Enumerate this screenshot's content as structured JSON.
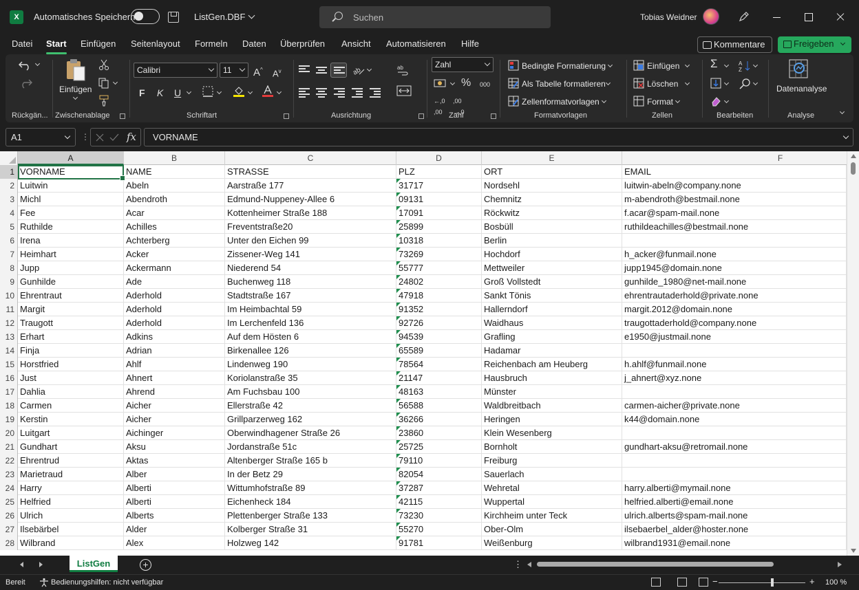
{
  "titlebar": {
    "autosave_label": "Automatisches Speichern",
    "filename": "ListGen.DBF",
    "search_placeholder": "Suchen",
    "user": "Tobias Weidner"
  },
  "menu": {
    "tabs": [
      "Datei",
      "Start",
      "Einfügen",
      "Seitenlayout",
      "Formeln",
      "Daten",
      "Überprüfen",
      "Ansicht",
      "Automatisieren",
      "Hilfe"
    ],
    "active_tab": "Start",
    "comments_label": "Kommentare",
    "share_label": "Freigeben"
  },
  "ribbon": {
    "undo_group": "Rückgän...",
    "clipboard": {
      "paste_label": "Einfügen",
      "group": "Zwischenablage"
    },
    "font": {
      "name": "Calibri",
      "size": "11",
      "bold": "F",
      "italic": "K",
      "underline": "U",
      "group": "Schriftart"
    },
    "alignment": {
      "group": "Ausrichtung"
    },
    "number": {
      "format": "Zahl",
      "group": "Zahl"
    },
    "styles": {
      "conditional": "Bedingte Formatierung",
      "as_table": "Als Tabelle formatieren",
      "cell_styles": "Zellenformatvorlagen",
      "group": "Formatvorlagen"
    },
    "cells": {
      "insert": "Einfügen",
      "delete": "Löschen",
      "format": "Format",
      "group": "Zellen"
    },
    "editing": {
      "group": "Bearbeiten"
    },
    "analysis": {
      "button": "Datenanalyse",
      "group": "Analyse"
    }
  },
  "formula_bar": {
    "name_box": "A1",
    "fx": "fx",
    "content": "VORNAME"
  },
  "sheet": {
    "columns": [
      "A",
      "B",
      "C",
      "D",
      "E",
      "F"
    ],
    "rows": [
      [
        "VORNAME",
        "NAME",
        "STRASSE",
        "PLZ",
        "ORT",
        "EMAIL"
      ],
      [
        "Luitwin",
        "Abeln",
        "Aarstraße 177",
        "31717",
        "Nordsehl",
        "luitwin-abeln@company.none"
      ],
      [
        "Michl",
        "Abendroth",
        "Edmund-Nuppeney-Allee 6",
        "09131",
        "Chemnitz",
        "m-abendroth@bestmail.none"
      ],
      [
        "Fee",
        "Acar",
        "Kottenheimer Straße 188",
        "17091",
        "Röckwitz",
        "f.acar@spam-mail.none"
      ],
      [
        "Ruthilde",
        "Achilles",
        "Freventstraße20",
        "25899",
        "Bosbüll",
        "ruthildeachilles@bestmail.none"
      ],
      [
        "Irena",
        "Achterberg",
        "Unter den Eichen 99",
        "10318",
        "Berlin",
        ""
      ],
      [
        "Heimhart",
        "Acker",
        "Zissener-Weg 141",
        "73269",
        "Hochdorf",
        "h_acker@funmail.none"
      ],
      [
        "Jupp",
        "Ackermann",
        "Niederend 54",
        "55777",
        "Mettweiler",
        "jupp1945@domain.none"
      ],
      [
        "Gunhilde",
        "Ade",
        "Buchenweg 118",
        "24802",
        "Groß Vollstedt",
        "gunhilde_1980@net-mail.none"
      ],
      [
        "Ehrentraut",
        "Aderhold",
        "Stadtstraße 167",
        "47918",
        "Sankt Tönis",
        "ehrentrautaderhold@private.none"
      ],
      [
        "Margit",
        "Aderhold",
        "Im Heimbachtal 59",
        "91352",
        "Hallerndorf",
        "margit.2012@domain.none"
      ],
      [
        "Traugott",
        "Aderhold",
        "Im Lerchenfeld 136",
        "92726",
        "Waidhaus",
        "traugottaderhold@company.none"
      ],
      [
        "Erhart",
        "Adkins",
        "Auf dem Hösten 6",
        "94539",
        "Grafling",
        "e1950@justmail.none"
      ],
      [
        "Finja",
        "Adrian",
        "Birkenallee 126",
        "65589",
        "Hadamar",
        ""
      ],
      [
        "Horstfried",
        "Ahlf",
        "Lindenweg 190",
        "78564",
        "Reichenbach am Heuberg",
        "h.ahlf@funmail.none"
      ],
      [
        "Just",
        "Ahnert",
        "Koriolanstraße 35",
        "21147",
        "Hausbruch",
        "j_ahnert@xyz.none"
      ],
      [
        "Dahlia",
        "Ahrend",
        "Am Fuchsbau 100",
        "48163",
        "Münster",
        ""
      ],
      [
        "Carmen",
        "Aicher",
        "Ellerstraße 42",
        "56588",
        "Waldbreitbach",
        "carmen-aicher@private.none"
      ],
      [
        "Kerstin",
        "Aicher",
        "Grillparzerweg 162",
        "36266",
        "Heringen",
        "k44@domain.none"
      ],
      [
        "Luitgart",
        "Aichinger",
        "Oberwindhagener Straße 26",
        "23860",
        "Klein Wesenberg",
        ""
      ],
      [
        "Gundhart",
        "Aksu",
        "Jordanstraße 51c",
        "25725",
        "Bornholt",
        "gundhart-aksu@retromail.none"
      ],
      [
        "Ehrentrud",
        "Aktas",
        "Altenberger Straße 165 b",
        "79110",
        "Freiburg",
        ""
      ],
      [
        "Marietraud",
        "Alber",
        "In der Betz 29",
        "82054",
        "Sauerlach",
        ""
      ],
      [
        "Harry",
        "Alberti",
        "Wittumhofstraße 89",
        "37287",
        "Wehretal",
        "harry.alberti@mymail.none"
      ],
      [
        "Helfried",
        "Alberti",
        "Eichenheck 184",
        "42115",
        "Wuppertal",
        "helfried.alberti@email.none"
      ],
      [
        "Ulrich",
        "Alberts",
        "Plettenberger Straße 133",
        "73230",
        "Kirchheim unter Teck",
        "ulrich.alberts@spam-mail.none"
      ],
      [
        "Ilsebärbel",
        "Alder",
        "Kolberger Straße 31",
        "55270",
        "Ober-Olm",
        "ilsebaerbel_alder@hoster.none"
      ],
      [
        "Wilbrand",
        "Alex",
        "Holzweg 142",
        "91781",
        "Weißenburg",
        "wilbrand1931@email.none"
      ]
    ],
    "tab_name": "ListGen"
  },
  "statusbar": {
    "ready": "Bereit",
    "accessibility": "Bedienungshilfen: nicht verfügbar",
    "zoom": "100 %"
  },
  "colors": {
    "accent": "#217346",
    "share": "#26a85d"
  }
}
